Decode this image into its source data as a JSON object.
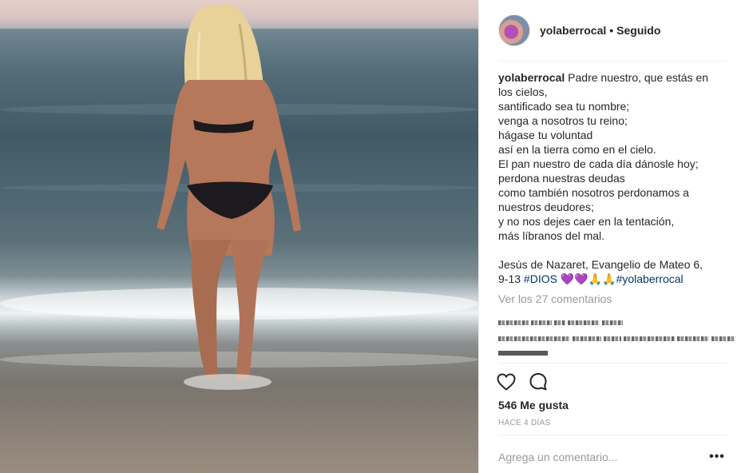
{
  "post": {
    "image_alt": "woman-at-sea-photo",
    "author": "yolaberrocal",
    "separator": "•",
    "follow_status": "Seguido",
    "caption": {
      "username": "yolaberrocal",
      "lines": [
        "Padre nuestro, que estás en",
        "los cielos,",
        "santificado sea tu nombre;",
        "venga a nosotros tu reino;",
        "hágase tu voluntad",
        "así en la tierra como en el cielo.",
        "El pan nuestro de cada día dánosle hoy;",
        "perdona nuestras deudas",
        "como también nosotros perdonamos a",
        "nuestros deudores;",
        "y no nos dejes caer en la tentación,",
        "más líbranos del mal."
      ],
      "source_line_1": "Jesús de Nazaret, Evangelio de Mateo 6,",
      "source_line_2_prefix": "9-13 ",
      "hashtag_1": "#DIOS",
      "emoji_hearts": "💜💜",
      "emoji_pray": "🙏🙏",
      "hashtag_2": "#yolaberrocal"
    },
    "view_comments": "Ver los 27 comentarios",
    "likes": "546 Me gusta",
    "date": "HACE 4 DÍAS",
    "comment_placeholder": "Agrega un comentario...",
    "more_options": "•••",
    "icons": {
      "like": "heart-icon",
      "comment": "comment-bubble-icon"
    },
    "colors": {
      "hashtag": "#003569",
      "muted": "#999999",
      "text": "#262626"
    }
  }
}
